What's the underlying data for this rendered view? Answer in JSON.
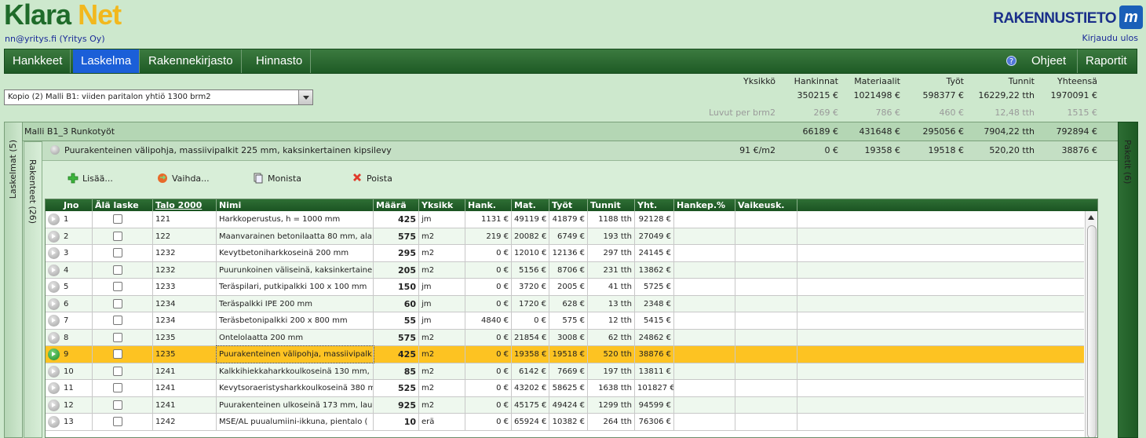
{
  "header": {
    "logo_part1": "Klara",
    "logo_part2": "Net",
    "user": "nn@yritys.fi (Yritys Oy)",
    "brand": "RAKENNUSTIETO",
    "logout": "Kirjaudu ulos"
  },
  "nav": {
    "tabs": [
      {
        "label": "Hankkeet"
      },
      {
        "label": "Laskelma"
      },
      {
        "label": "Rakennekirjasto"
      },
      {
        "label": "Hinnasto"
      }
    ],
    "active": "Laskelma",
    "right": [
      {
        "label": "Ohjeet"
      },
      {
        "label": "Raportit"
      }
    ]
  },
  "summary": {
    "headers": [
      "Yksikkö",
      "Hankinnat",
      "Materiaalit",
      "Työt",
      "Tunnit",
      "Yhteensä"
    ],
    "totals": [
      "350215 €",
      "1021498 €",
      "598377 €",
      "16229,22 tth",
      "1970091 €"
    ],
    "per_label": "Luvut per brm2",
    "per": [
      "269 €",
      "786 €",
      "460 €",
      "12,48 tth",
      "1515 €"
    ]
  },
  "select": {
    "value": "Kopio (2) Malli B1: viiden paritalon yhtiö 1300 brm2"
  },
  "side": {
    "laskelmat": "Laskelmat (5)",
    "rakenteet": "Rakenteet (26)",
    "paketit": "Paketit (6)"
  },
  "group": {
    "name": "Malli B1_3 Runkotyöt",
    "values": [
      "66189 €",
      "431648 €",
      "295056 €",
      "7904,22 tth",
      "792894 €"
    ]
  },
  "item": {
    "name": "Puurakenteinen välipohja, massiivipalkit 225 mm, kaksinkertainen kipsilevy",
    "unit": "91 €/m2",
    "values": [
      "0 €",
      "19358 €",
      "19518 €",
      "520,20 tth",
      "38876 €"
    ]
  },
  "toolbar": {
    "add": "Lisää...",
    "change": "Vaihda...",
    "copy": "Monista",
    "delete": "Poista"
  },
  "grid": {
    "columns": [
      "Jno",
      "Älä laske",
      "Talo 2000",
      "Nimi",
      "Määrä",
      "Yksikk",
      "Hank.",
      "Mat.",
      "Työt",
      "Tunnit",
      "Yht.",
      "Hankep.%",
      "Vaikeusk."
    ],
    "rows": [
      [
        "1",
        "121",
        "Harkkoperustus, h = 1000 mm",
        "425",
        "jm",
        "1131 €",
        "49119 €",
        "41879 €",
        "1188 tth",
        "92128 €"
      ],
      [
        "2",
        "122",
        "Maanvarainen betonilaatta 80 mm, ala",
        "575",
        "m2",
        "219 €",
        "20082 €",
        "6749 €",
        "193 tth",
        "27049 €"
      ],
      [
        "3",
        "1232",
        "Kevytbetoniharkkoseinä 200 mm",
        "295",
        "m2",
        "0 €",
        "12010 €",
        "12136 €",
        "297 tth",
        "24145 €"
      ],
      [
        "4",
        "1232",
        "Puurunkoinen väliseinä, kaksinkertaine",
        "205",
        "m2",
        "0 €",
        "5156 €",
        "8706 €",
        "231 tth",
        "13862 €"
      ],
      [
        "5",
        "1233",
        "Teräspilari, putkipalkki 100 x 100 mm",
        "150",
        "jm",
        "0 €",
        "3720 €",
        "2005 €",
        "41 tth",
        "5725 €"
      ],
      [
        "6",
        "1234",
        "Teräspalkki IPE 200 mm",
        "60",
        "jm",
        "0 €",
        "1720 €",
        "628 €",
        "13 tth",
        "2348 €"
      ],
      [
        "7",
        "1234",
        "Teräsbetonipalkki 200 x 800 mm",
        "55",
        "jm",
        "4840 €",
        "0 €",
        "575 €",
        "12 tth",
        "5415 €"
      ],
      [
        "8",
        "1235",
        "Ontelolaatta 200 mm",
        "575",
        "m2",
        "0 €",
        "21854 €",
        "3008 €",
        "62 tth",
        "24862 €"
      ],
      [
        "9",
        "1235",
        "Puurakenteinen välipohja, massiivipalk",
        "425",
        "m2",
        "0 €",
        "19358 €",
        "19518 €",
        "520 tth",
        "38876 €"
      ],
      [
        "10",
        "1241",
        "Kalkkihiekkaharkkoulkoseinä 130 mm,",
        "85",
        "m2",
        "0 €",
        "6142 €",
        "7669 €",
        "197 tth",
        "13811 €"
      ],
      [
        "11",
        "1241",
        "Kevytsoraeristysharkkoulkoseinä 380 m",
        "525",
        "m2",
        "0 €",
        "43202 €",
        "58625 €",
        "1638 tth",
        "101827 €"
      ],
      [
        "12",
        "1241",
        "Puurakenteinen ulkoseinä 173 mm, lau",
        "925",
        "m2",
        "0 €",
        "45175 €",
        "49424 €",
        "1299 tth",
        "94599 €"
      ],
      [
        "13",
        "1242",
        "MSE/AL puualumiini-ikkuna, pientalo (",
        "10",
        "erä",
        "0 €",
        "65924 €",
        "10382 €",
        "264 tth",
        "76306 €"
      ]
    ],
    "selected_index": 8
  },
  "colors": {
    "accent": "#1b5fd8",
    "selected_row": "#fdc322",
    "nav": "#2a6b30",
    "background": "#cde8cd"
  }
}
